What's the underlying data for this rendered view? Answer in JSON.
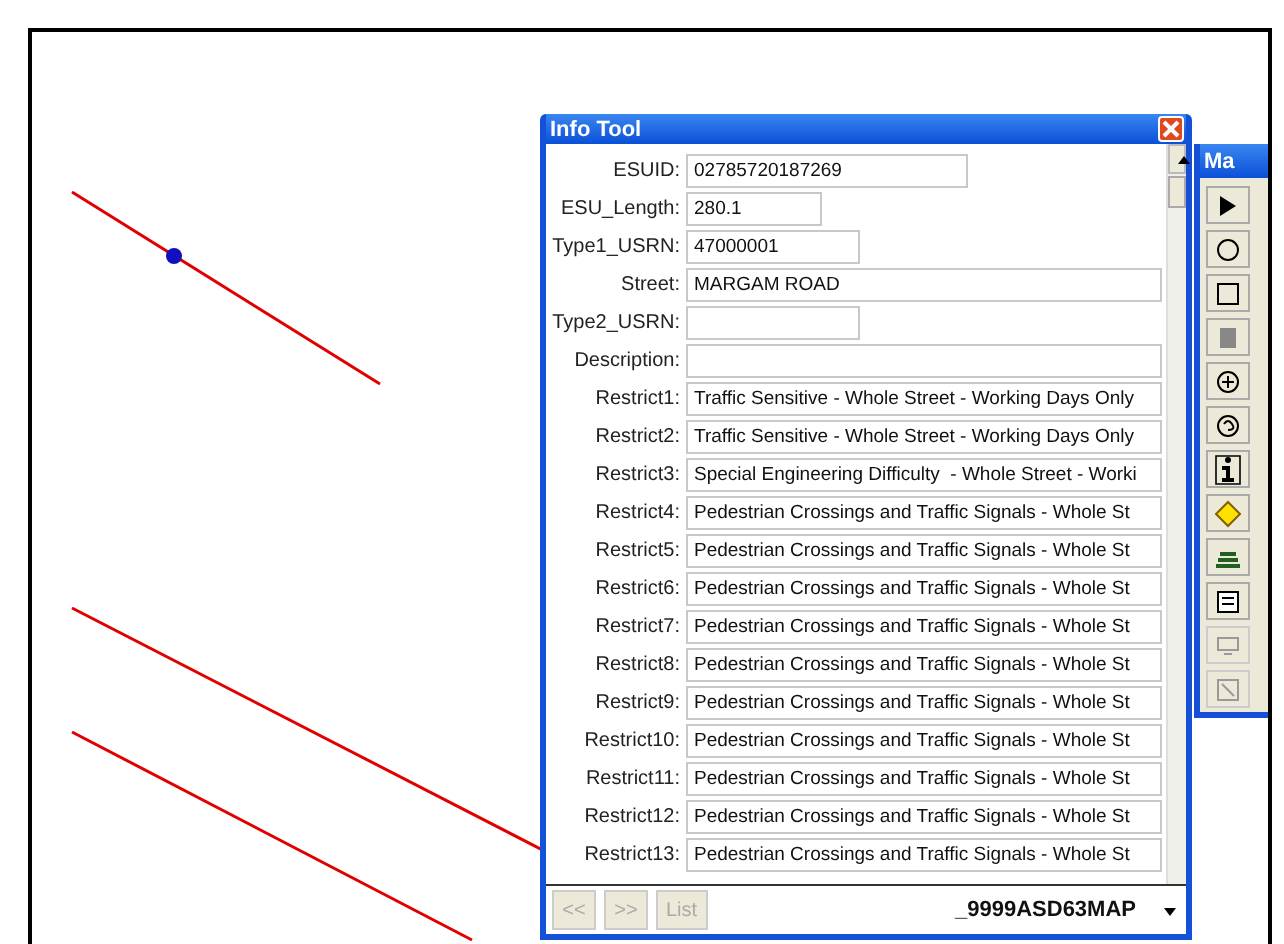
{
  "info_window": {
    "title": "Info Tool",
    "fields": [
      {
        "label": "ESUID:",
        "value": "02785720187269",
        "kind": "medium"
      },
      {
        "label": "ESU_Length:",
        "value": "280.1",
        "kind": "short"
      },
      {
        "label": "Type1_USRN:",
        "value": "47000001",
        "kind": "narrow"
      },
      {
        "label": "Street:",
        "value": "MARGAM ROAD",
        "kind": "wide"
      },
      {
        "label": "Type2_USRN:",
        "kind": "narrow"
      },
      {
        "label": "Description:",
        "kind": "wide"
      },
      {
        "label": "Restrict1:",
        "value": "Traffic Sensitive - Whole Street - Working Days Only",
        "kind": "wide"
      },
      {
        "label": "Restrict2:",
        "value": "Traffic Sensitive - Whole Street - Working Days Only",
        "kind": "wide"
      },
      {
        "label": "Restrict3:",
        "value": "Special Engineering Difficulty  - Whole Street - Worki",
        "kind": "wide"
      },
      {
        "label": "Restrict4:",
        "value": "Pedestrian Crossings and Traffic Signals - Whole St",
        "kind": "wide"
      },
      {
        "label": "Restrict5:",
        "value": "Pedestrian Crossings and Traffic Signals - Whole St",
        "kind": "wide"
      },
      {
        "label": "Restrict6:",
        "value": "Pedestrian Crossings and Traffic Signals - Whole St",
        "kind": "wide"
      },
      {
        "label": "Restrict7:",
        "value": "Pedestrian Crossings and Traffic Signals - Whole St",
        "kind": "wide"
      },
      {
        "label": "Restrict8:",
        "value": "Pedestrian Crossings and Traffic Signals - Whole St",
        "kind": "wide"
      },
      {
        "label": "Restrict9:",
        "value": "Pedestrian Crossings and Traffic Signals - Whole St",
        "kind": "wide"
      },
      {
        "label": "Restrict10:",
        "value": "Pedestrian Crossings and Traffic Signals - Whole St",
        "kind": "wide"
      },
      {
        "label": "Restrict11:",
        "value": "Pedestrian Crossings and Traffic Signals - Whole St",
        "kind": "wide"
      },
      {
        "label": "Restrict12:",
        "value": "Pedestrian Crossings and Traffic Signals - Whole St",
        "kind": "wide"
      },
      {
        "label": "Restrict13:",
        "value": "Pedestrian Crossings and Traffic Signals - Whole St",
        "kind": "wide"
      }
    ],
    "buttons": [
      {
        "label": "<<",
        "disabled": true
      },
      {
        "label": ">>",
        "disabled": true
      },
      {
        "label": "List",
        "disabled": true
      }
    ],
    "layer_name": "_9999ASD63MAP"
  },
  "toolbar_window": {
    "title": "Ma",
    "tools": [
      {
        "disabled": false
      },
      {
        "disabled": false
      },
      {
        "disabled": false
      },
      {
        "disabled": false
      },
      {
        "disabled": false
      },
      {
        "disabled": false
      },
      {
        "disabled": false
      },
      {
        "disabled": false
      },
      {
        "disabled": false
      },
      {
        "disabled": false
      },
      {
        "disabled": true
      },
      {
        "disabled": true
      }
    ]
  }
}
